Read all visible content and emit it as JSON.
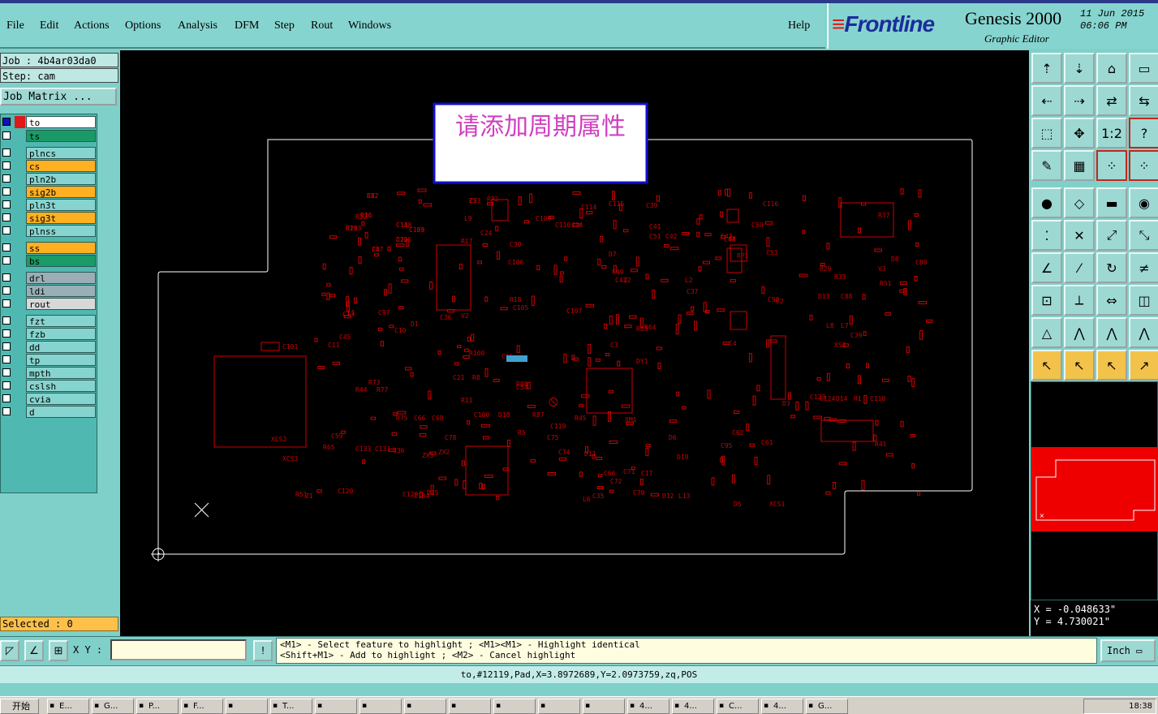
{
  "menu": {
    "items": [
      "File",
      "Edit",
      "Actions",
      "Options",
      "Analysis",
      "DFM",
      "Step",
      "Rout",
      "Windows"
    ],
    "help": "Help"
  },
  "logo": {
    "brand": "Frontline",
    "product": "Genesis 2000",
    "subtitle": "Graphic Editor",
    "date": "11 Jun 2015",
    "time": "06:06 PM"
  },
  "job": {
    "job_text": "Job : 4b4ar03da0",
    "step_text": "Step: cam",
    "matrix_button": "Job Matrix ..."
  },
  "layers": [
    {
      "name": "to",
      "color": "#ffffff",
      "selected": true,
      "mark": "✎"
    },
    {
      "name": "ts",
      "color": "#1a9a66"
    },
    {
      "name": "plncs",
      "color": "#86d4cf"
    },
    {
      "name": "cs",
      "color": "#ffb020",
      "mark": "✎"
    },
    {
      "name": "pln2b",
      "color": "#86d4cf"
    },
    {
      "name": "sig2b",
      "color": "#ffb020",
      "mark": "✎"
    },
    {
      "name": "pln3t",
      "color": "#86d4cf"
    },
    {
      "name": "sig3t",
      "color": "#ffb020"
    },
    {
      "name": "plnss",
      "color": "#86d4cf"
    },
    {
      "name": "ss",
      "color": "#ffb020",
      "mark": "✎"
    },
    {
      "name": "bs",
      "color": "#1a9a66"
    },
    {
      "name": "drl",
      "color": "#9aaeb6"
    },
    {
      "name": "ldi",
      "color": "#9aaeb6"
    },
    {
      "name": "rout",
      "color": "#d8d8d8"
    },
    {
      "name": "fzt",
      "color": "#86d4cf"
    },
    {
      "name": "fzb",
      "color": "#86d4cf"
    },
    {
      "name": "dd",
      "color": "#86d4cf"
    },
    {
      "name": "tp",
      "color": "#86d4cf"
    },
    {
      "name": "mpth",
      "color": "#86d4cf"
    },
    {
      "name": "cslsh",
      "color": "#86d4cf"
    },
    {
      "name": "cvia",
      "color": "#86d4cf"
    },
    {
      "name": "d",
      "color": "#86d4cf"
    }
  ],
  "selected_text": "Selected : 0",
  "canvas": {
    "notice": "请添加周期属性",
    "labels": [
      "C12",
      "C16",
      "R20",
      "C14",
      "C103",
      "C105",
      "C57",
      "C23",
      "RP2",
      "L9",
      "C24",
      "R17",
      "C30",
      "C106",
      "C109",
      "C110",
      "C34",
      "C114",
      "C115",
      "C39",
      "C41",
      "C51",
      "C42",
      "C116",
      "C50",
      "C44",
      "C47",
      "RP1",
      "C53",
      "R22",
      "L1",
      "C36",
      "V2",
      "R18",
      "C105",
      "C107",
      "D7",
      "C49",
      "C43",
      "Z2",
      "L2",
      "C37",
      "C2",
      "C98",
      "C97",
      "C45",
      "C11",
      "C10",
      "C13",
      "D1",
      "C101",
      "R44",
      "R77",
      "R73",
      "R75",
      "C66",
      "C68",
      "C21",
      "R11",
      "R8",
      "C100",
      "R88",
      "C54",
      "D18",
      "R87",
      "R100",
      "C15",
      "R5",
      "C119",
      "C75",
      "C74",
      "D11",
      "C66",
      "C72",
      "C71",
      "C17",
      "C70",
      "D19",
      "D6",
      "C95",
      "C62",
      "C61",
      "C59",
      "R65",
      "C133",
      "C131",
      "C36",
      "ZX1",
      "ZX2",
      "C78",
      "R51",
      "Z1",
      "C120",
      "C129",
      "C134",
      "D15",
      "L6",
      "C35",
      "D12",
      "L13",
      "D5",
      "XCS1",
      "XCS2",
      "XCS3",
      "D3",
      "R45",
      "XM1",
      "DY1",
      "R63",
      "R64",
      "D13",
      "C88",
      "C39",
      "R51",
      "V3",
      "D8",
      "C80",
      "R29",
      "R35",
      "L7",
      "L8",
      "C123",
      "C124",
      "D14",
      "R1",
      "C118",
      "R41",
      "R37",
      "C3",
      "C4",
      "XS2",
      "R82",
      "R26",
      "C113",
      "C138",
      "C139",
      "D22",
      "Z4",
      "Z5"
    ]
  },
  "tools": {
    "rows": 10,
    "cols": 4
  },
  "coords": {
    "x": "X = -0.048633\"",
    "y": "Y = 4.730021\""
  },
  "bottom": {
    "xy_label": "X Y :",
    "xy_value": "",
    "hint_line1": "<M1> - Select feature to highlight ; <M1><M1> - Highlight identical",
    "hint_line2": "<Shift+M1> - Add to highlight ; <M2> - Cancel highlight",
    "units": "Inch"
  },
  "status_text": "to,#12119,Pad,X=3.8972689,Y=2.0973759,zq,POS",
  "taskbar": {
    "start": "开始",
    "tasks": [
      "E...",
      "G...",
      "P...",
      "F...",
      "",
      "T...",
      "",
      "",
      "",
      "",
      "",
      "",
      "",
      "4...",
      "4...",
      "C...",
      "4...",
      "G..."
    ],
    "clock": "18:38"
  },
  "colors": {
    "panel": "#7fd0c8",
    "accent_red": "#e01818",
    "pcb": "#d00000",
    "highlight": "#ffb020"
  }
}
